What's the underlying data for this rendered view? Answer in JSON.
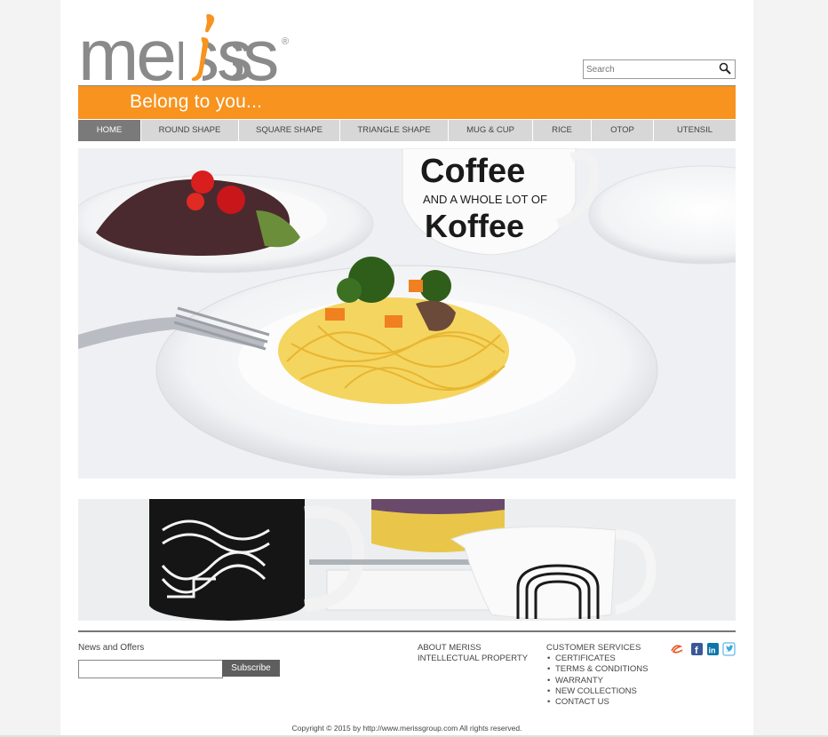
{
  "brand": {
    "logo_text": "meriss",
    "registered": "®",
    "accent_color": "#f7931e"
  },
  "search": {
    "placeholder": "Search",
    "icon": "search-icon"
  },
  "banner": {
    "tagline": "Belong to you..."
  },
  "nav": {
    "items": [
      {
        "label": "HOME",
        "active": true
      },
      {
        "label": "ROUND SHAPE"
      },
      {
        "label": "SQUARE SHAPE"
      },
      {
        "label": "TRIANGLE SHAPE"
      },
      {
        "label": "MUG & CUP"
      },
      {
        "label": "RICE"
      },
      {
        "label": "OTOP"
      },
      {
        "label": "UTENSIL"
      }
    ]
  },
  "hero": {
    "mug_line1": "Coffee",
    "mug_line2": "AND A WHOLE LOT OF",
    "mug_line3": "Koffee"
  },
  "footer": {
    "news_title": "News and Offers",
    "subscribe_label": "Subscribe",
    "links_col1": [
      "ABOUT MERISS",
      "INTELLECTUAL PROPERTY"
    ],
    "customer_services": {
      "heading": "CUSTOMER SERVICES",
      "items": [
        "CERTIFICATES",
        "TERMS & CONDITIONS",
        "WARRANTY",
        "NEW COLLECTIONS",
        "CONTACT US"
      ]
    },
    "social": [
      "alibaba-icon",
      "facebook-icon",
      "linkedin-icon",
      "twitter-icon"
    ],
    "copyright": "Copyright © 2015 by http://www.merissgroup.com All rights reserved."
  }
}
